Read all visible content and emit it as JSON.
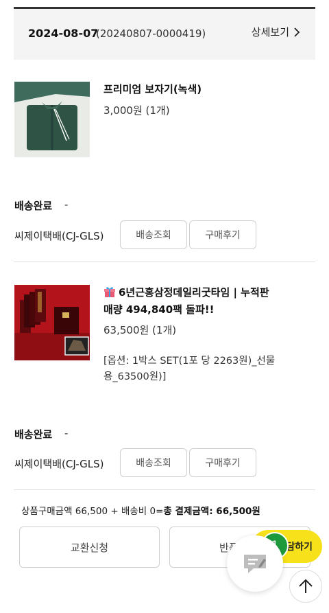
{
  "order": {
    "date": "2024-08-07",
    "number": "(20240807-0000419)",
    "detail_label": "상세보기"
  },
  "items": [
    {
      "name": "프리미엄 보자기(녹색)",
      "price": "3,000원 (1개)",
      "shipping_status": "배송완료",
      "dash": "-",
      "carrier": "씨제이택배(CJ-GLS)",
      "track_label": "배송조회",
      "review_label": "구매후기"
    },
    {
      "name_line1": "6년근홍삼정데일리굿타임 | 누적판",
      "name_line2": "매량 494,840팩 돌파!!",
      "price": "63,500원 (1개)",
      "option_line1": "[옵션: 1박스 SET(1포 당 2263원)_선물",
      "option_line2": "용_63500원)]",
      "shipping_status": "배송완료",
      "dash": "-",
      "carrier": "씨제이택배(CJ-GLS)",
      "track_label": "배송조회",
      "review_label": "구매후기"
    }
  ],
  "summary": {
    "text": "상품구매금액 66,500 + 배송비 0=",
    "total_label": "총 결제금액: 66,500원"
  },
  "actions": {
    "exchange_label": "교환신청",
    "return_label": "반품"
  },
  "floating": {
    "cart_badge": "1",
    "cart_label": "담하기",
    "cart_color": "#f7e11b",
    "badge_color": "#1e9a3d"
  }
}
